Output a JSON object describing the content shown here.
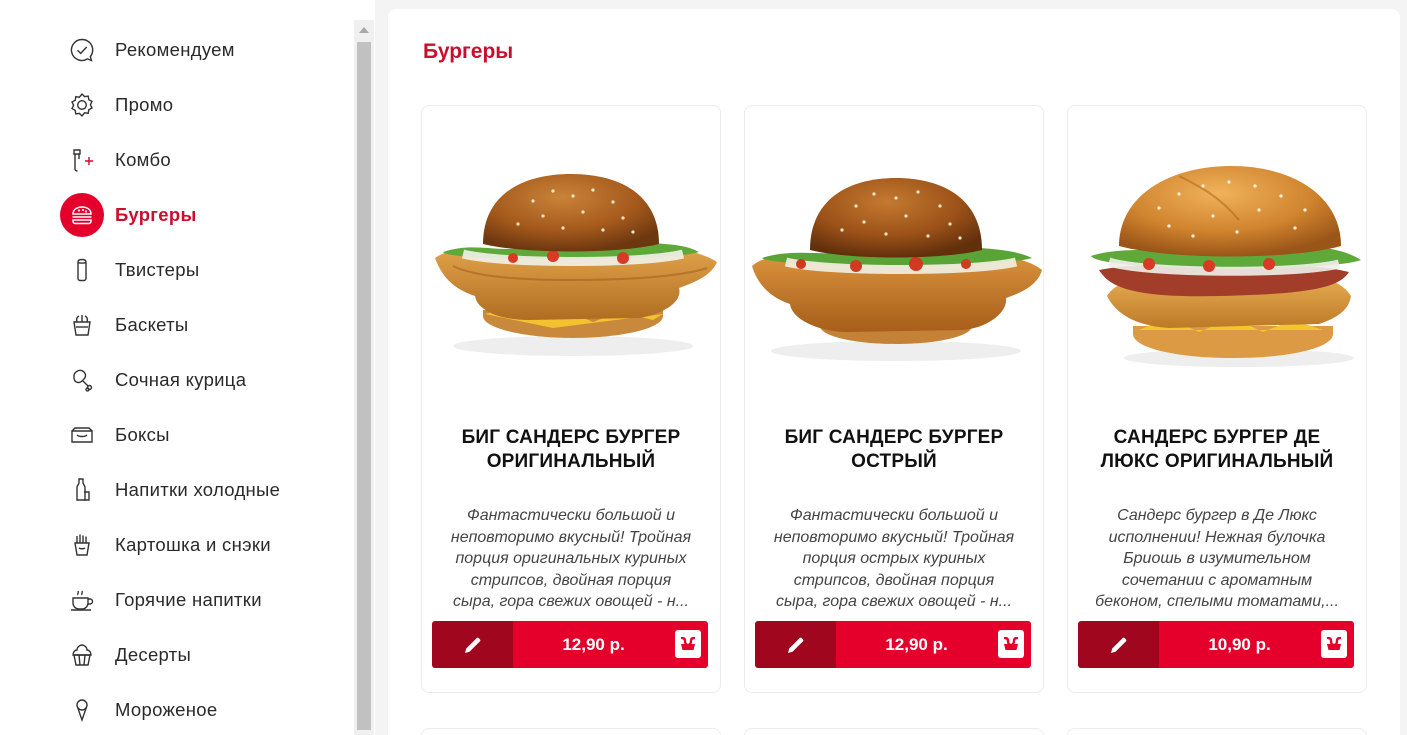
{
  "sidebar": {
    "items": [
      {
        "label": "Рекомендуем",
        "icon": "check-bubble-icon"
      },
      {
        "label": "Промо",
        "icon": "promo-gear-icon"
      },
      {
        "label": "Комбо",
        "icon": "combo-plus-icon"
      },
      {
        "label": "Бургеры",
        "icon": "burger-icon",
        "active": true
      },
      {
        "label": "Твистеры",
        "icon": "twister-icon"
      },
      {
        "label": "Баскеты",
        "icon": "basket-icon"
      },
      {
        "label": "Сочная курица",
        "icon": "chicken-leg-icon"
      },
      {
        "label": "Боксы",
        "icon": "box-icon"
      },
      {
        "label": "Напитки холодные",
        "icon": "cold-drink-icon"
      },
      {
        "label": "Картошка и снэки",
        "icon": "fries-icon"
      },
      {
        "label": "Горячие напитки",
        "icon": "hot-drink-icon"
      },
      {
        "label": "Десерты",
        "icon": "dessert-icon"
      },
      {
        "label": "Мороженое",
        "icon": "ice-cream-icon"
      }
    ]
  },
  "main": {
    "section_title": "Бургеры",
    "products": [
      {
        "name": "БИГ САНДЕРС БУРГЕР ОРИГИНАЛЬНЫЙ",
        "description_lines": [
          "Фантастически большой и",
          "неповторимо вкусный! Тройная",
          "порция оригинальных куриных",
          "стрипсов, двойная порция",
          "сыра, гора свежих овощей - н..."
        ],
        "price": "12,90 р.",
        "image": "burger-original-photo"
      },
      {
        "name": "БИГ САНДЕРС БУРГЕР ОСТРЫЙ",
        "description_lines": [
          "Фантастически большой и",
          "неповторимо вкусный! Тройная",
          "порция острых куриных",
          "стрипсов, двойная порция",
          "сыра, гора свежих овощей - н..."
        ],
        "price": "12,90 р.",
        "image": "burger-spicy-photo"
      },
      {
        "name": "САНДЕРС БУРГЕР ДЕ ЛЮКС ОРИГИНАЛЬНЫЙ",
        "description_lines": [
          "Сандерс бургер в Де Люкс",
          "исполнении! Нежная булочка",
          "Бриошь в изумительном",
          "сочетании с ароматным",
          "беконом, спелыми томатами,..."
        ],
        "price": "10,90 р.",
        "image": "burger-deluxe-photo"
      }
    ]
  },
  "colors": {
    "accent": "#e4002b",
    "accent_dark": "#a0061e",
    "active_text": "#c8102e"
  }
}
